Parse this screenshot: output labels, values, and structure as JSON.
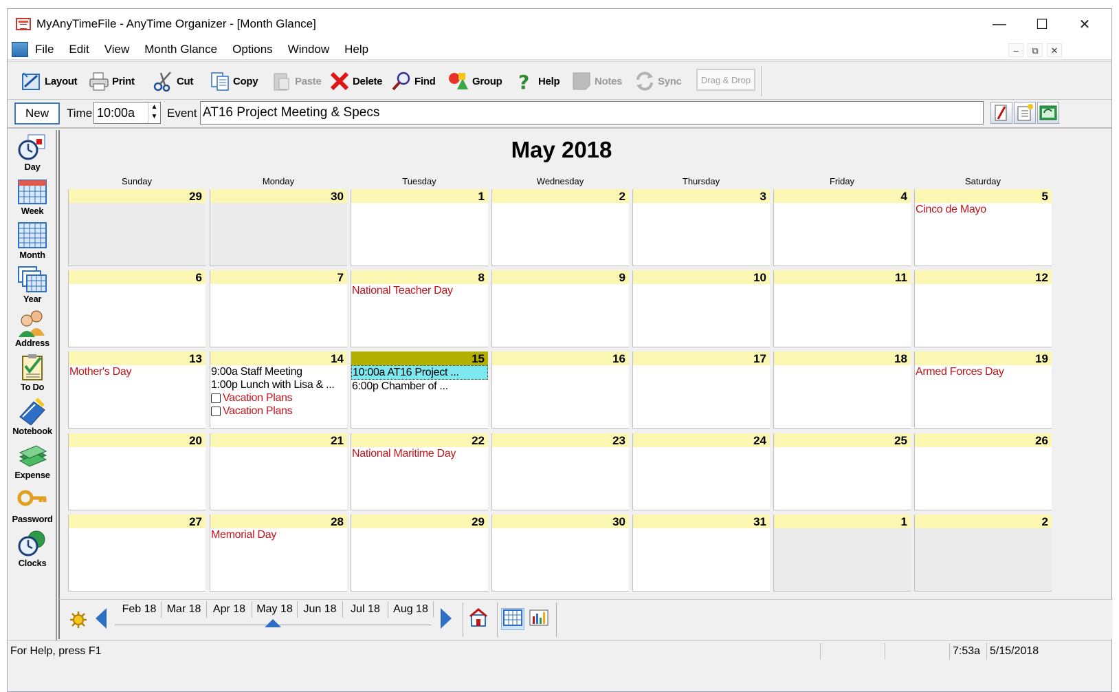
{
  "window": {
    "title": "MyAnyTimeFile - AnyTime Organizer - [Month Glance]",
    "min_glyph": "—",
    "max_glyph": "☐",
    "close_glyph": "✕"
  },
  "menu": {
    "items": [
      "File",
      "Edit",
      "View",
      "Month Glance",
      "Options",
      "Window",
      "Help"
    ],
    "mdi_min": "–",
    "mdi_restore": "⧉",
    "mdi_close": "✕"
  },
  "toolbar": {
    "buttons": [
      {
        "label": "Layout",
        "icon": "layout-icon",
        "enabled": true
      },
      {
        "label": "Print",
        "icon": "print-icon",
        "enabled": true
      },
      {
        "label": "Cut",
        "icon": "scissors-icon",
        "enabled": true
      },
      {
        "label": "Copy",
        "icon": "copy-icon",
        "enabled": true
      },
      {
        "label": "Paste",
        "icon": "paste-icon",
        "enabled": false
      },
      {
        "label": "Delete",
        "icon": "delete-icon",
        "enabled": true
      },
      {
        "label": "Find",
        "icon": "magnifier-icon",
        "enabled": true
      },
      {
        "label": "Group",
        "icon": "group-icon",
        "enabled": true
      },
      {
        "label": "Help",
        "icon": "help-icon",
        "enabled": true
      },
      {
        "label": "Notes",
        "icon": "notes-icon",
        "enabled": false
      },
      {
        "label": "Sync",
        "icon": "sync-icon",
        "enabled": false
      }
    ],
    "drag_drop": "Drag & Drop"
  },
  "entry": {
    "new_label": "New",
    "time_label": "Time",
    "time_value": "10:00a",
    "event_label": "Event",
    "event_value": "AT16 Project Meeting & Specs"
  },
  "sidenav": {
    "items": [
      {
        "label": "Day",
        "icon": "day-clock-icon"
      },
      {
        "label": "Week",
        "icon": "week-calendar-icon"
      },
      {
        "label": "Month",
        "icon": "month-calendar-icon"
      },
      {
        "label": "Year",
        "icon": "year-calendar-icon"
      },
      {
        "label": "Address",
        "icon": "address-people-icon"
      },
      {
        "label": "To Do",
        "icon": "todo-clipboard-icon"
      },
      {
        "label": "Notebook",
        "icon": "notebook-icon"
      },
      {
        "label": "Expense",
        "icon": "money-icon"
      },
      {
        "label": "Password",
        "icon": "key-icon"
      },
      {
        "label": "Clocks",
        "icon": "world-clock-icon"
      }
    ]
  },
  "calendar": {
    "title": "May 2018",
    "days_of_week": [
      "Sunday",
      "Monday",
      "Tuesday",
      "Wednesday",
      "Thursday",
      "Friday",
      "Saturday"
    ],
    "weeks": [
      [
        {
          "day": "29",
          "other": true,
          "events": []
        },
        {
          "day": "30",
          "other": true,
          "events": []
        },
        {
          "day": "1",
          "events": []
        },
        {
          "day": "2",
          "events": []
        },
        {
          "day": "3",
          "events": []
        },
        {
          "day": "4",
          "events": []
        },
        {
          "day": "5",
          "events": [
            {
              "text": "Cinco de Mayo",
              "kind": "holiday"
            }
          ]
        }
      ],
      [
        {
          "day": "6",
          "events": []
        },
        {
          "day": "7",
          "events": []
        },
        {
          "day": "8",
          "events": [
            {
              "text": "National Teacher Day",
              "kind": "holiday"
            }
          ]
        },
        {
          "day": "9",
          "events": []
        },
        {
          "day": "10",
          "events": []
        },
        {
          "day": "11",
          "events": []
        },
        {
          "day": "12",
          "events": []
        }
      ],
      [
        {
          "day": "13",
          "events": [
            {
              "text": "Mother's Day",
              "kind": "holiday"
            }
          ]
        },
        {
          "day": "14",
          "events": [
            {
              "text": "9:00a Staff Meeting",
              "kind": "appt"
            },
            {
              "text": "1:00p Lunch with Lisa & ...",
              "kind": "appt"
            },
            {
              "text": "Vacation Plans",
              "kind": "task"
            },
            {
              "text": "Vacation Plans",
              "kind": "task"
            }
          ]
        },
        {
          "day": "15",
          "today": true,
          "events": [
            {
              "text": "10:00a AT16 Project ...",
              "kind": "selected"
            },
            {
              "text": "6:00p Chamber of ...",
              "kind": "appt"
            }
          ]
        },
        {
          "day": "16",
          "events": []
        },
        {
          "day": "17",
          "events": []
        },
        {
          "day": "18",
          "events": []
        },
        {
          "day": "19",
          "events": [
            {
              "text": "Armed Forces Day",
              "kind": "holiday"
            }
          ]
        }
      ],
      [
        {
          "day": "20",
          "events": []
        },
        {
          "day": "21",
          "events": []
        },
        {
          "day": "22",
          "events": [
            {
              "text": "National Maritime Day",
              "kind": "holiday"
            }
          ]
        },
        {
          "day": "23",
          "events": []
        },
        {
          "day": "24",
          "events": []
        },
        {
          "day": "25",
          "events": []
        },
        {
          "day": "26",
          "events": []
        }
      ],
      [
        {
          "day": "27",
          "events": []
        },
        {
          "day": "28",
          "events": [
            {
              "text": "Memorial Day",
              "kind": "holiday"
            }
          ]
        },
        {
          "day": "29",
          "events": []
        },
        {
          "day": "30",
          "events": []
        },
        {
          "day": "31",
          "events": []
        },
        {
          "day": "1",
          "other": true,
          "events": []
        },
        {
          "day": "2",
          "other": true,
          "events": []
        }
      ]
    ]
  },
  "month_tabs": {
    "tabs": [
      "Feb 18",
      "Mar 18",
      "Apr 18",
      "May 18",
      "Jun 18",
      "Jul 18",
      "Aug 18"
    ],
    "selected": "May 18"
  },
  "status": {
    "help_text": "For Help, press F1",
    "time": "7:53a",
    "date": "5/15/2018"
  },
  "colors": {
    "date_header": "#fbf7b3",
    "today_header": "#b4b000",
    "holiday_text": "#c0141b",
    "selected_event": "#7de8f0",
    "accent_blue": "#2d6fc4"
  }
}
